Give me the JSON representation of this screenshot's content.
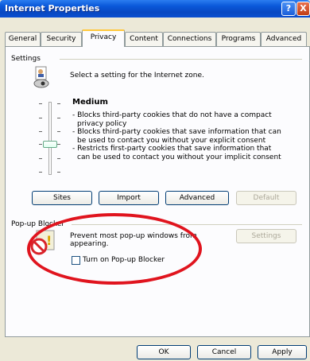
{
  "window": {
    "title": "Internet Properties"
  },
  "title_buttons": {
    "help": "?",
    "close": "X"
  },
  "tabs": [
    "General",
    "Security",
    "Privacy",
    "Content",
    "Connections",
    "Programs",
    "Advanced"
  ],
  "active_tab": "Privacy",
  "settings": {
    "group_label": "Settings",
    "intro": "Select a setting for the Internet zone.",
    "level": "Medium",
    "description": [
      "- Blocks third-party cookies that do not have a compact",
      "privacy policy",
      "- Blocks third-party cookies that save information that can",
      "be used to contact you without your explicit consent",
      "- Restricts first-party cookies that save information that",
      "can be used to contact you without your implicit consent"
    ],
    "slider_position_fraction": 0.5,
    "buttons": {
      "sites": "Sites",
      "import": "Import",
      "advanced": "Advanced",
      "default": "Default"
    }
  },
  "popup": {
    "group_label": "Pop-up Blocker",
    "text": [
      "Prevent most pop-up windows from",
      "appearing."
    ],
    "settings_button": "Settings",
    "checkbox_label": "Turn on Pop-up Blocker",
    "checkbox_checked": false
  },
  "footer": {
    "ok": "OK",
    "cancel": "Cancel",
    "apply": "Apply"
  },
  "colors": {
    "annotation": "#e0141e",
    "title_bar": "#0a58d9",
    "tab_highlight": "#ffc83c"
  }
}
